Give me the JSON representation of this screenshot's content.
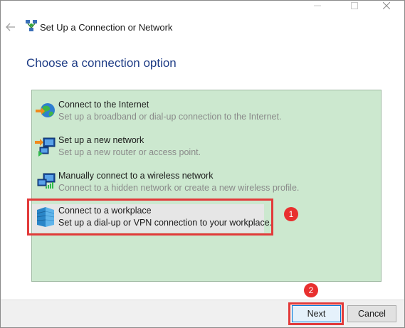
{
  "window": {
    "title": "Set Up a Connection or Network",
    "caption_buttons": {
      "minimize": "—",
      "maximize": "☐",
      "close": "✕"
    }
  },
  "page": {
    "heading": "Choose a connection option"
  },
  "options": [
    {
      "title": "Connect to the Internet",
      "description": "Set up a broadband or dial-up connection to the Internet.",
      "icon": "globe-network-icon",
      "selected": false
    },
    {
      "title": "Set up a new network",
      "description": "Set up a new router or access point.",
      "icon": "new-network-icon",
      "selected": false
    },
    {
      "title": "Manually connect to a wireless network",
      "description": "Connect to a hidden network or create a new wireless profile.",
      "icon": "wireless-network-icon",
      "selected": false
    },
    {
      "title": "Connect to a workplace",
      "description": "Set up a dial-up or VPN connection to your workplace.",
      "icon": "workplace-building-icon",
      "selected": true
    }
  ],
  "annotations": {
    "badge_1": "1",
    "badge_2": "2",
    "color": "#e23a3a"
  },
  "footer": {
    "next_label": "Next",
    "cancel_label": "Cancel"
  },
  "colors": {
    "accent": "#1f3d86",
    "panel_bg": "#cce8cf",
    "selection_bg": "#e6e6e6",
    "default_button_border": "#0078d7"
  }
}
